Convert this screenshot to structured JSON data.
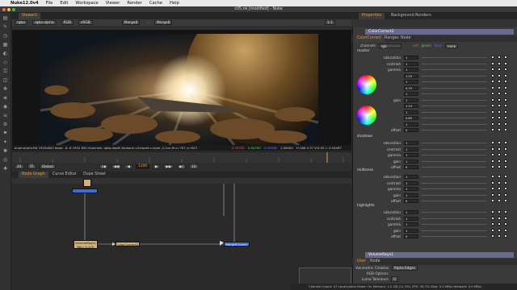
{
  "menubar": {
    "app_name": "Nuke12.0v4",
    "items": [
      "File",
      "Edit",
      "Workspace",
      "Viewer",
      "Render",
      "Cache",
      "Help"
    ]
  },
  "window": {
    "title": "c05.nk [modified] - Nuke"
  },
  "viewer": {
    "tab_label": "Viewer1",
    "layer": "rgba",
    "channel": "rgba.alpha",
    "colorspace_display": "RGB",
    "lut": "sRGB",
    "input_a": "Merge8",
    "input_b": "Merge8",
    "zoom": "1:1",
    "info_left": "anamorphicHD 1920x842  bbox: -8 -8 1932 850 channels: rgba,depth,forward.u,forward.v,layer_0,2un,M  x=707 y=623",
    "pixel_r": "0.03735",
    "pixel_g": "0.04790",
    "pixel_b": "0.03036",
    "pixel_a": "1.00000",
    "info_right": "H:166 0.37 V:0.05  L: 0.04467",
    "playback": {
      "fps": "24",
      "frame": "1106",
      "end_frame": "10",
      "mode_label": "TF",
      "global_label": "Global"
    }
  },
  "node_graph": {
    "tabs": [
      "Node Graph",
      "Curve Editor",
      "Dope Sheet"
    ],
    "nodes": {
      "read": "Read1",
      "grade": "VolumeRays1",
      "grade_sub": "Bbn: 0.1(0)",
      "colorcorrect": "ColorCorrect2",
      "merge": "Merge8 (over)"
    }
  },
  "properties": {
    "tabs": [
      "Properties",
      "Background Renders"
    ],
    "node_title": "ColorCorrect2",
    "node_tabs": [
      "ColorCorrect",
      "Ranges",
      "Node"
    ],
    "channels_label": "channels",
    "channels_value": "rgb",
    "channel_toggles": [
      "red",
      "green",
      "blue",
      "none"
    ],
    "sections": {
      "master": {
        "label": "master",
        "rows": [
          {
            "label": "saturation",
            "value": "1"
          },
          {
            "label": "contrast",
            "value": "1"
          },
          {
            "label": "gamma",
            "value": "1"
          },
          {
            "label": "",
            "value": "1.25"
          },
          {
            "label": "",
            "value": "1"
          },
          {
            "label": "",
            "value": "0.75"
          },
          {
            "label": "",
            "value": "1"
          },
          {
            "label": "gain",
            "value": "1"
          },
          {
            "label": "",
            "value": "1.13"
          },
          {
            "label": "",
            "value": "1"
          },
          {
            "label": "",
            "value": "0.85"
          },
          {
            "label": "",
            "value": "1"
          },
          {
            "label": "offset",
            "value": "0"
          }
        ]
      },
      "shadows": {
        "label": "shadows",
        "rows": [
          {
            "label": "saturation",
            "value": "1"
          },
          {
            "label": "contrast",
            "value": "1"
          },
          {
            "label": "gamma",
            "value": "1"
          },
          {
            "label": "gain",
            "value": "1"
          },
          {
            "label": "offset",
            "value": "0"
          }
        ]
      },
      "midtones": {
        "label": "midtones",
        "rows": [
          {
            "label": "saturation",
            "value": "1"
          },
          {
            "label": "contrast",
            "value": "1"
          },
          {
            "label": "gamma",
            "value": "1"
          },
          {
            "label": "gain",
            "value": "1"
          },
          {
            "label": "offset",
            "value": "0"
          }
        ]
      },
      "highlights": {
        "label": "highlights",
        "rows": [
          {
            "label": "saturation",
            "value": "1"
          },
          {
            "label": "contrast",
            "value": "1"
          },
          {
            "label": "gamma",
            "value": "1"
          },
          {
            "label": "gain",
            "value": "1"
          },
          {
            "label": "offset",
            "value": "0"
          }
        ]
      }
    },
    "volume_node": {
      "title": "VolumeRays1",
      "tabs": [
        "User",
        "Node"
      ],
      "creation_label": "Volumetric Creation",
      "creation_value": "Alpha Edges",
      "rgb_options_label": "RGB Options",
      "luma_label": "Luma Tolerance",
      "luma_value": "0"
    }
  },
  "status_bar": {
    "text": "Channel Count: 47  Localization Mode: On  Memory: 2.2 GB (11.3%)  CPU: 36.7%  Disk: 0.0 MB/s  Network: 0.0 MB/s"
  },
  "colors": {
    "accent_orange": "#e59a2c",
    "node_blue": "#3f6ad8",
    "node_tan": "#d2b27c",
    "node_title_bar": "#6a6a8c"
  }
}
